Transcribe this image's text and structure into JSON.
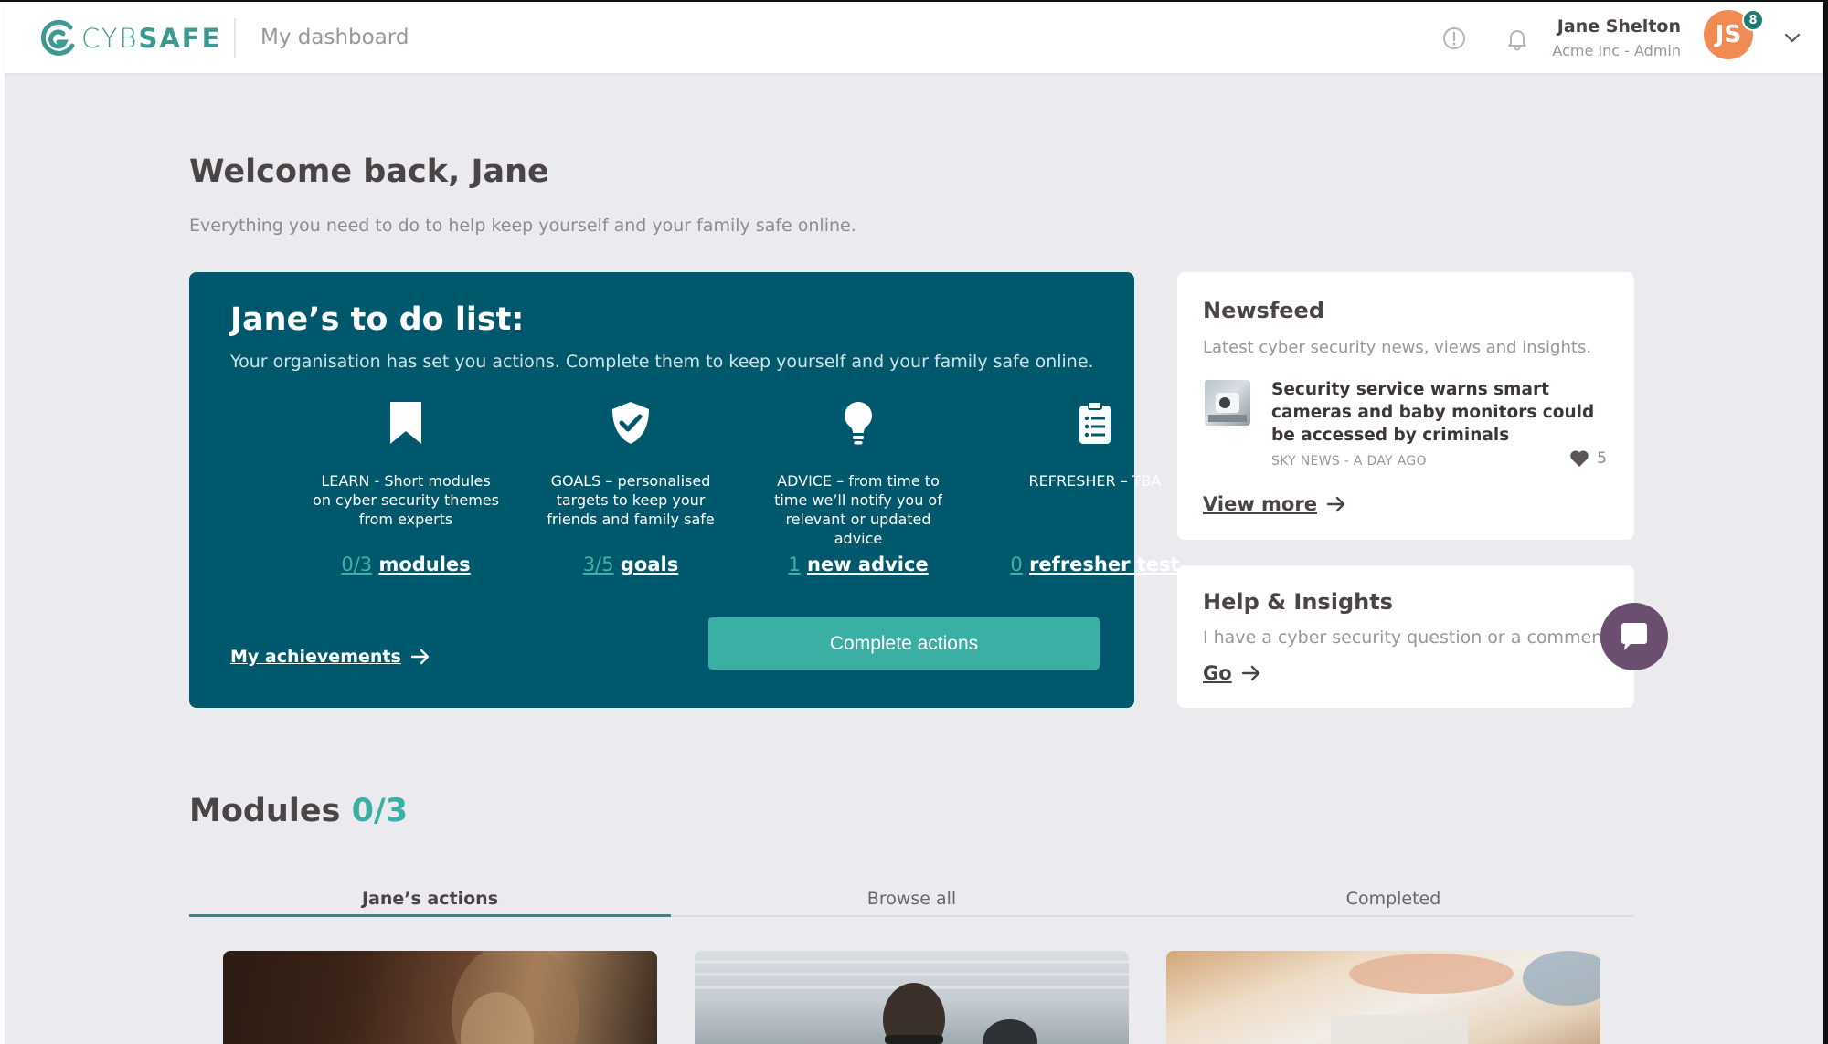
{
  "header": {
    "logo": {
      "light": "CYB",
      "bold": "SAFE"
    },
    "page_name": "My dashboard",
    "user": {
      "name": "Jane Shelton",
      "org": "Acme Inc - Admin",
      "initials": "JS",
      "notifications": "8"
    },
    "icons": [
      "alert-icon",
      "bell-icon",
      "chevron-down-icon"
    ]
  },
  "welcome": {
    "title": "Welcome back, Jane",
    "subtitle": "Everything you need to do to help keep yourself and your family safe online."
  },
  "todo": {
    "title": "Jane’s to do list:",
    "subtitle": "Your organisation has set you actions. Complete them to keep yourself and your family safe online.",
    "columns": [
      {
        "icon": "bookmark-icon",
        "text": "LEARN - Short modules on cyber security themes from experts",
        "count": "0/3",
        "link": "modules"
      },
      {
        "icon": "shield-check-icon",
        "text": "GOALS – personalised targets to keep your friends and family safe",
        "count": "3/5",
        "link": "goals"
      },
      {
        "icon": "lightbulb-icon",
        "text": "ADVICE – from time to time we’ll notify you of relevant or updated advice",
        "count": "1",
        "link": "new advice"
      },
      {
        "icon": "clipboard-icon",
        "text": "REFRESHER – TBA",
        "count": "0",
        "link": "refresher test"
      }
    ],
    "achievements": "My achievements",
    "complete_button": "Complete actions"
  },
  "newsfeed": {
    "title": "Newsfeed",
    "subtitle": "Latest cyber security news, views and insights.",
    "item": {
      "headline": "Security service warns smart cameras and baby monitors could be accessed by criminals",
      "meta": "SKY NEWS - A DAY AGO",
      "likes": "5"
    },
    "view_more": "View more"
  },
  "help": {
    "title": "Help & Insights",
    "subtitle": "I have a cyber security question or a comment",
    "go": "Go"
  },
  "modules": {
    "title": "Modules",
    "count": "0/3",
    "tabs": [
      {
        "label": "Jane’s actions",
        "active": true
      },
      {
        "label": "Browse all",
        "active": false
      },
      {
        "label": "Completed",
        "active": false
      }
    ]
  },
  "colors": {
    "brand_teal": "#00586c",
    "accent": "#3aafa3",
    "avatar": "#f08b53",
    "chat": "#6a4f6f"
  }
}
